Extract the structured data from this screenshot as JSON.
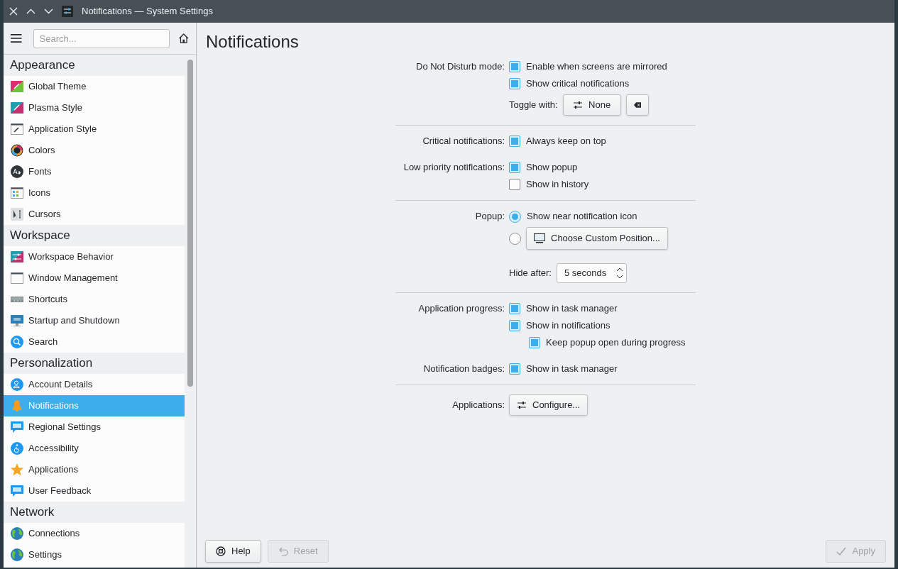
{
  "window": {
    "title": "Notifications — System Settings"
  },
  "sidebar": {
    "search": {
      "placeholder": "Search..."
    },
    "categories": [
      {
        "title": "Appearance",
        "items": [
          {
            "label": "Global Theme",
            "selected": false
          },
          {
            "label": "Plasma Style",
            "selected": false
          },
          {
            "label": "Application Style",
            "selected": false
          },
          {
            "label": "Colors",
            "selected": false
          },
          {
            "label": "Fonts",
            "selected": false
          },
          {
            "label": "Icons",
            "selected": false
          },
          {
            "label": "Cursors",
            "selected": false
          }
        ]
      },
      {
        "title": "Workspace",
        "items": [
          {
            "label": "Workspace Behavior",
            "selected": false
          },
          {
            "label": "Window Management",
            "selected": false
          },
          {
            "label": "Shortcuts",
            "selected": false
          },
          {
            "label": "Startup and Shutdown",
            "selected": false
          },
          {
            "label": "Search",
            "selected": false
          }
        ]
      },
      {
        "title": "Personalization",
        "items": [
          {
            "label": "Account Details",
            "selected": false
          },
          {
            "label": "Notifications",
            "selected": true
          },
          {
            "label": "Regional Settings",
            "selected": false
          },
          {
            "label": "Accessibility",
            "selected": false
          },
          {
            "label": "Applications",
            "selected": false
          },
          {
            "label": "User Feedback",
            "selected": false
          }
        ]
      },
      {
        "title": "Network",
        "items": [
          {
            "label": "Connections",
            "selected": false
          },
          {
            "label": "Settings",
            "selected": false
          }
        ]
      }
    ]
  },
  "page": {
    "title": "Notifications",
    "sections": [
      {
        "groups": [
          {
            "rows": [
              {
                "label": "Do Not Disturb mode:",
                "controls": [
                  {
                    "kind": "checkbox",
                    "text": "Enable when screens are mirrored",
                    "checked": true
                  }
                ]
              },
              {
                "controls": [
                  {
                    "kind": "checkbox",
                    "text": "Show critical notifications",
                    "checked": true
                  }
                ]
              },
              {
                "controls": [
                  {
                    "kind": "text",
                    "text": "Toggle with:"
                  },
                  {
                    "kind": "shortcut-button",
                    "text": "None"
                  },
                  {
                    "kind": "clear-button"
                  }
                ]
              }
            ]
          }
        ]
      },
      {
        "groups": [
          {
            "rows": [
              {
                "label": "Critical notifications:",
                "controls": [
                  {
                    "kind": "checkbox",
                    "text": "Always keep on top",
                    "checked": true
                  }
                ]
              }
            ]
          },
          {
            "rows": [
              {
                "label": "Low priority notifications:",
                "controls": [
                  {
                    "kind": "checkbox",
                    "text": "Show popup",
                    "checked": true
                  }
                ]
              },
              {
                "controls": [
                  {
                    "kind": "checkbox",
                    "text": "Show in history",
                    "checked": false
                  }
                ]
              }
            ]
          }
        ]
      },
      {
        "groups": [
          {
            "rows": [
              {
                "label": "Popup:",
                "controls": [
                  {
                    "kind": "radio",
                    "text": "Show near notification icon",
                    "selected": true
                  }
                ]
              },
              {
                "controls": [
                  {
                    "kind": "radio",
                    "selected": false
                  },
                  {
                    "kind": "position-button",
                    "text": "Choose Custom Position..."
                  }
                ]
              }
            ]
          },
          {
            "rows": [
              {
                "controls": [
                  {
                    "kind": "text",
                    "text": "Hide after:"
                  },
                  {
                    "kind": "spinbox",
                    "text": "5 seconds"
                  }
                ]
              }
            ]
          }
        ]
      },
      {
        "groups": [
          {
            "rows": [
              {
                "label": "Application progress:",
                "controls": [
                  {
                    "kind": "checkbox",
                    "text": "Show in task manager",
                    "checked": true
                  }
                ]
              },
              {
                "controls": [
                  {
                    "kind": "checkbox",
                    "text": "Show in notifications",
                    "checked": true,
                    "children": [
                      {
                        "kind": "checkbox",
                        "text": "Keep popup open during progress",
                        "checked": true
                      }
                    ]
                  }
                ]
              }
            ]
          },
          {
            "rows": [
              {
                "label": "Notification badges:",
                "controls": [
                  {
                    "kind": "checkbox",
                    "text": "Show in task manager",
                    "checked": true
                  }
                ]
              }
            ]
          }
        ]
      },
      {
        "groups": [
          {
            "rows": [
              {
                "label": "Applications:",
                "controls": [
                  {
                    "kind": "configure-button",
                    "text": "Configure..."
                  }
                ]
              }
            ]
          }
        ]
      }
    ]
  },
  "footer": {
    "buttons": [
      {
        "kind": "help",
        "text": "Help",
        "disabled": false
      },
      {
        "kind": "reset",
        "text": "Reset",
        "disabled": true
      },
      {
        "kind": "apply",
        "text": "Apply",
        "disabled": true
      }
    ]
  }
}
